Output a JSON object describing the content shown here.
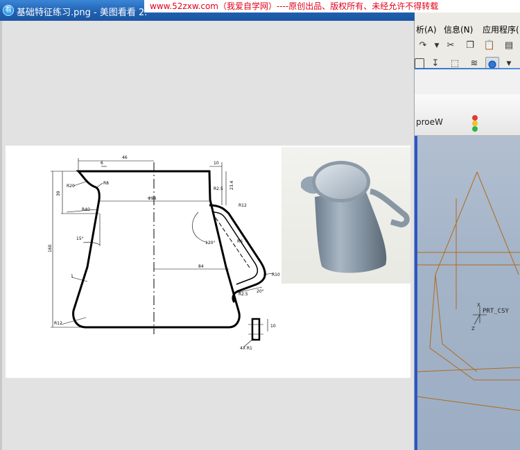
{
  "viewer": {
    "app_icon_glyph": "看",
    "title": "基础特征练习.png - 美图看看 2."
  },
  "watermark": {
    "text": "www.52zxw.com（我爱自学网）----原创出品、版权所有、未经允许不得转载"
  },
  "drawing": {
    "dims": {
      "top_width": "46",
      "top_small": "6",
      "top_right": "10",
      "r20": "R20",
      "r8": "R8",
      "d39": "39",
      "r40": "R40",
      "phi98": "Φ98",
      "angle15": "15°",
      "height160": "160",
      "thickness1": "1",
      "r12_bottom": "R12",
      "r25": "R2.5",
      "d234": "23.4",
      "r12_top": "R12",
      "angle120": "120°",
      "r6": "R6",
      "d84": "84",
      "r10": "R10",
      "r25b": "R2.5",
      "angle20": "20°",
      "d10": "10",
      "d4x": "4X R1"
    }
  },
  "proe": {
    "menu": {
      "analysis": "析(A)",
      "info": "信息(N)",
      "apps": "应用程序("
    },
    "toolbar_icons": [
      "redo-icon",
      "cut-icon",
      "copy-icon",
      "paste-icon",
      "paste-special-icon"
    ],
    "tab_label": "proeW",
    "csys_label": "PRT_CSY",
    "csys_axis_z": "Z",
    "csys_axis_x": "X",
    "colors": {
      "model_lines": "#b06a1a",
      "graphics_bg": "#a4b4c8",
      "accent_blue": "#2b56c8"
    }
  }
}
